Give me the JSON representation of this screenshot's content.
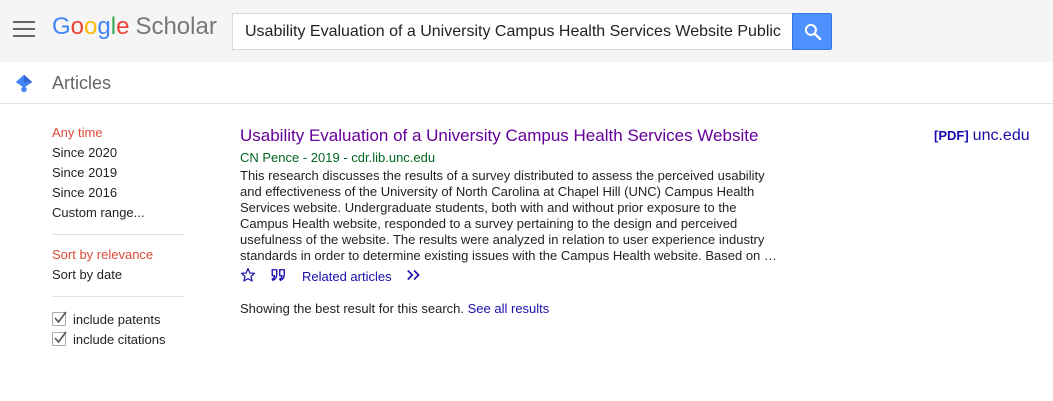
{
  "header": {
    "logo_letters": [
      "G",
      "o",
      "o",
      "g",
      "l",
      "e"
    ],
    "logo_colors": [
      "#4285f4",
      "#ea4335",
      "#fbbc05",
      "#4285f4",
      "#34a853",
      "#ea4335"
    ],
    "logo_suffix": "Scholar",
    "search_value": "Usability Evaluation of a University Campus Health Services Website Public",
    "menu_icon": "hamburger-menu-icon",
    "search_icon": "search-icon"
  },
  "subheader": {
    "title": "Articles",
    "icon": "scholar-cap-icon"
  },
  "sidebar": {
    "time_filters": [
      "Any time",
      "Since 2020",
      "Since 2019",
      "Since 2016",
      "Custom range..."
    ],
    "sort_options": [
      "Sort by relevance",
      "Sort by date"
    ],
    "checkboxes": [
      {
        "label": "include patents",
        "checked": true
      },
      {
        "label": "include citations",
        "checked": true
      }
    ],
    "active_color": "#dd4b39"
  },
  "result": {
    "title": "Usability Evaluation of a University Campus Health Services Website",
    "meta": "CN Pence - 2019 - cdr.lib.unc.edu",
    "snippet": "This research discusses the results of a survey distributed to assess the perceived usability and effectiveness of the University of North Carolina at Chapel Hill (UNC) Campus Health Services website. Undergraduate students, both with and without prior exposure to the Campus Health website, responded to a survey pertaining to the design and perceived usefulness of the website. The results were analyzed in relation to user experience industry standards in order to determine existing issues with the Campus Health website. Based on …",
    "related_label": "Related articles",
    "pdf_tag": "[PDF]",
    "pdf_domain": "unc.edu",
    "icons": [
      "star-icon",
      "quote-icon",
      "more-icon"
    ]
  },
  "footer": {
    "best_result_text": "Showing the best result for this search.",
    "see_all_label": "See all results"
  }
}
